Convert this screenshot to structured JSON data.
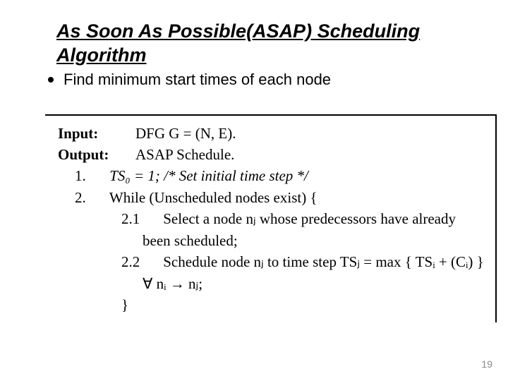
{
  "title": "As Soon As Possible(ASAP) Scheduling Algorithm",
  "bullet": "Find minimum start times of each node",
  "algo": {
    "inputLabel": "Input:",
    "inputValue": "DFG  G = (N, E).",
    "outputLabel": "Output:",
    "outputValue": "ASAP Schedule.",
    "step1_num": "1.",
    "step1_text": "TS₀ = 1; /* Set initial time step */",
    "step2_num": "2.",
    "step2_text": "While    (Unscheduled nodes exist) {",
    "step21_num": "2.1",
    "step21_line1": "Select a node nⱼ whose predecessors have already",
    "step21_line2": "been scheduled;",
    "step22_num": "2.2",
    "step22_line1": "Schedule node nⱼ to time step TSⱼ  =  max { TSᵢ  +  (Cᵢ) }",
    "step22_line2": "∀  nᵢ → nⱼ;",
    "close_brace": "}"
  },
  "pageNumber": "19"
}
